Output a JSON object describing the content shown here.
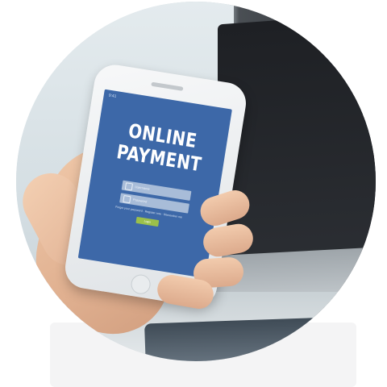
{
  "phone_screen": {
    "title_line1": "ONLINE",
    "title_line2": "PAYMENT",
    "username_placeholder": "Username",
    "password_placeholder": "Password",
    "links_text": "Forgot your password · Register now · Remember me",
    "login_label": "Login",
    "status_text": "9:41"
  },
  "colors": {
    "screen_blue": "#3d68a8",
    "login_green": "#9bc04a"
  }
}
